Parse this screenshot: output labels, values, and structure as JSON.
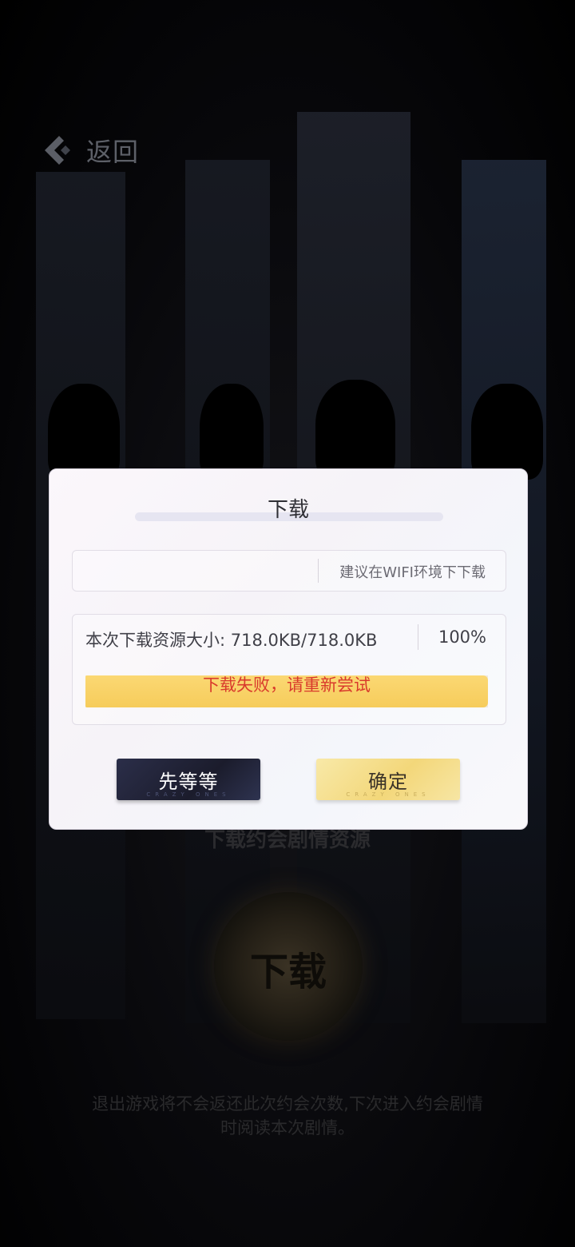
{
  "header": {
    "back_label": "返回"
  },
  "background": {
    "title": "下载约会剧情资源",
    "circle_label": "下载",
    "note": "退出游戏将不会返还此次约会次数,下次进入约会剧情时阅读本次剧情。"
  },
  "dialog": {
    "title": "下载",
    "tip": "建议在WIFI环境下下载",
    "size_text": "本次下载资源大小: 718.0KB/718.0KB",
    "percent_text": "100%",
    "progress": 1.0,
    "fail_message": "下载失败，请重新尝试",
    "wait_button": {
      "label": "先等等",
      "sub": "CRAZY ONES"
    },
    "ok_button": {
      "label": "确定",
      "sub": "CRAZY ONES"
    }
  },
  "colors": {
    "accent_gold": "#f6cc5b",
    "error_red": "#d93a2c",
    "dark_button": "#1f2134"
  }
}
